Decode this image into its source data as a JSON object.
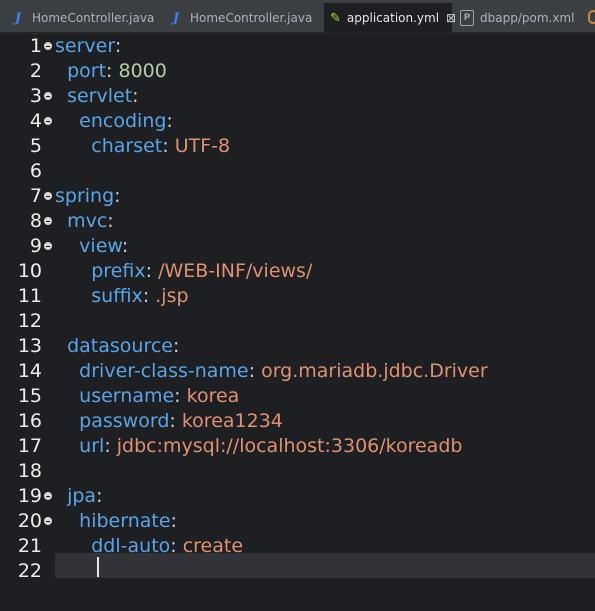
{
  "tabs": [
    {
      "label": "HomeController.java",
      "icon": "java-file-icon",
      "active": false
    },
    {
      "label": "HomeController.java",
      "icon": "java-file-icon",
      "active": false
    },
    {
      "label": "application.yml",
      "icon": "yaml-file-icon",
      "active": true,
      "close": "⊠"
    },
    {
      "label": "dbapp/pom.xml",
      "icon": "pom-file-icon",
      "active": false
    }
  ],
  "icons": {
    "java": "J",
    "pom": "P",
    "yml": "✎"
  },
  "colors": {
    "keyword": "#5aa5e6",
    "string": "#e0916f",
    "number": "#b5cea8",
    "background": "#1e1f22"
  },
  "editor": {
    "lines": [
      {
        "num": "1",
        "indent": "",
        "key": "server",
        "sep": ":",
        "value": "",
        "fold": true
      },
      {
        "num": "2",
        "indent": "  ",
        "key": "port",
        "sep": ": ",
        "value": "8000",
        "vclass": "n"
      },
      {
        "num": "3",
        "indent": "  ",
        "key": "servlet",
        "sep": ":",
        "value": "",
        "fold": true
      },
      {
        "num": "4",
        "indent": "    ",
        "key": "encoding",
        "sep": ":",
        "value": "",
        "fold": true
      },
      {
        "num": "5",
        "indent": "      ",
        "key": "charset",
        "sep": ": ",
        "value": "UTF-8"
      },
      {
        "num": "6",
        "indent": "",
        "key": "",
        "sep": "",
        "value": ""
      },
      {
        "num": "7",
        "indent": "",
        "key": "spring",
        "sep": ":",
        "value": "",
        "fold": true
      },
      {
        "num": "8",
        "indent": "  ",
        "key": "mvc",
        "sep": ":",
        "value": "",
        "fold": true
      },
      {
        "num": "9",
        "indent": "    ",
        "key": "view",
        "sep": ":",
        "value": "",
        "fold": true
      },
      {
        "num": "10",
        "indent": "      ",
        "key": "prefix",
        "sep": ": ",
        "value": "/WEB-INF/views/"
      },
      {
        "num": "11",
        "indent": "      ",
        "key": "suffix",
        "sep": ": ",
        "value": ".jsp"
      },
      {
        "num": "12",
        "indent": "",
        "key": "",
        "sep": "",
        "value": ""
      },
      {
        "num": "13",
        "indent": "  ",
        "key": "datasource",
        "sep": ":",
        "value": ""
      },
      {
        "num": "14",
        "indent": "    ",
        "key": "driver-class-name",
        "sep": ": ",
        "value": "org.mariadb.jdbc.Driver"
      },
      {
        "num": "15",
        "indent": "    ",
        "key": "username",
        "sep": ": ",
        "value": "korea"
      },
      {
        "num": "16",
        "indent": "    ",
        "key": "password",
        "sep": ": ",
        "value": "korea1234"
      },
      {
        "num": "17",
        "indent": "    ",
        "key": "url",
        "sep": ": ",
        "value": "jdbc:mysql://localhost:3306/koreadb"
      },
      {
        "num": "18",
        "indent": "",
        "key": "",
        "sep": "",
        "value": ""
      },
      {
        "num": "19",
        "indent": "  ",
        "key": "jpa",
        "sep": ":",
        "value": "",
        "fold": true
      },
      {
        "num": "20",
        "indent": "    ",
        "key": "hibernate",
        "sep": ":",
        "value": "",
        "fold": true
      },
      {
        "num": "21",
        "indent": "      ",
        "key": "ddl-auto",
        "sep": ": ",
        "value": "create"
      },
      {
        "num": "22",
        "indent": "",
        "key": "",
        "sep": "",
        "value": ""
      }
    ]
  }
}
